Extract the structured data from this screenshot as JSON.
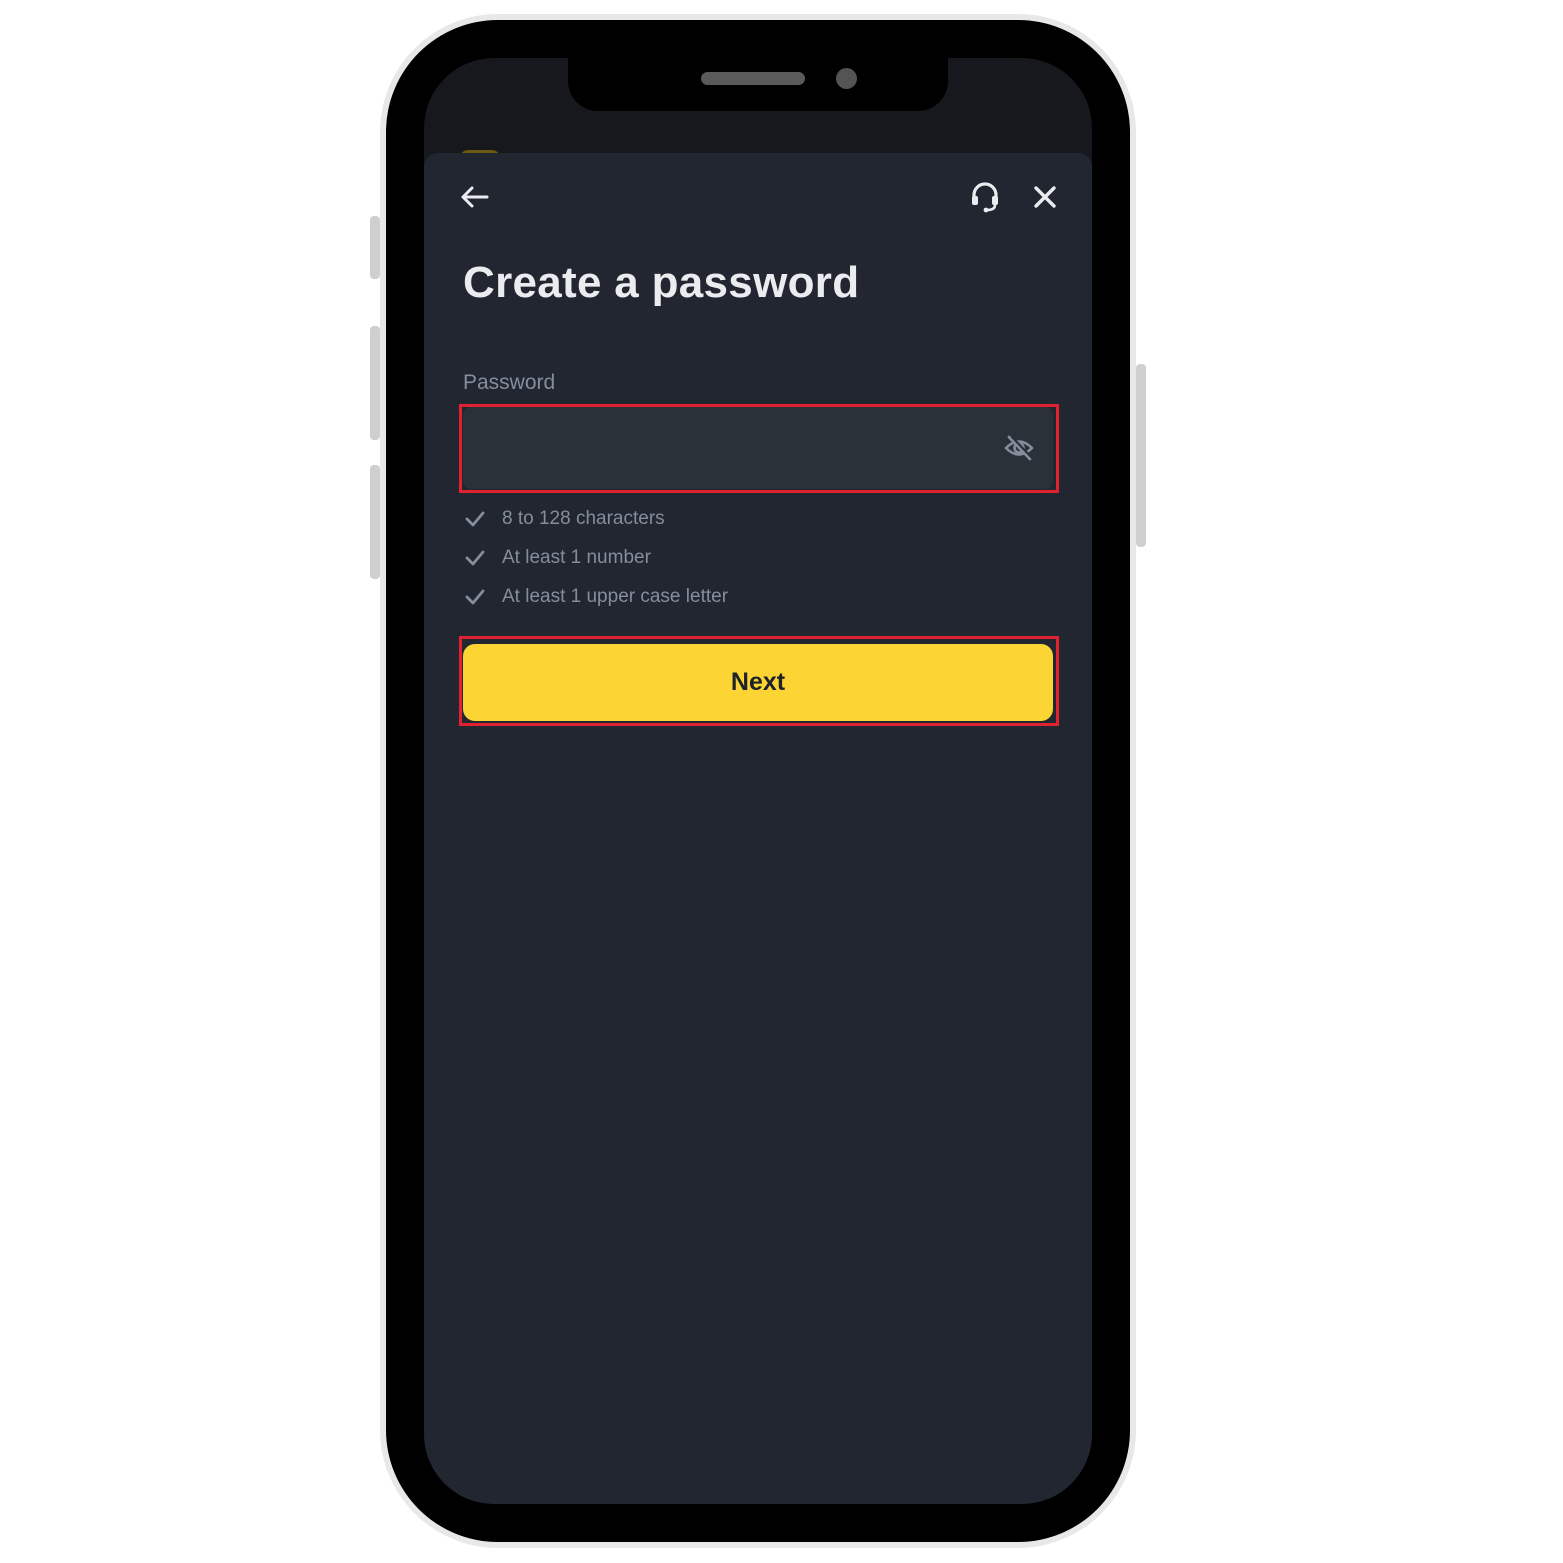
{
  "screen": {
    "title": "Create a password"
  },
  "header": {
    "back_icon": "arrow-left-icon",
    "support_icon": "headset-icon",
    "close_icon": "close-icon"
  },
  "password_field": {
    "label": "Password",
    "value": "",
    "toggle_icon": "eye-off-icon"
  },
  "requirements": [
    {
      "text": "8 to 128 characters",
      "icon": "check-icon"
    },
    {
      "text": "At least 1 number",
      "icon": "check-icon"
    },
    {
      "text": "At least 1 upper case letter",
      "icon": "check-icon"
    }
  ],
  "next_button": {
    "label": "Next"
  },
  "colors": {
    "accent": "#fcd535",
    "background": "#222630",
    "input_bg": "#2b3139",
    "highlight": "#e0212f",
    "muted_text": "#848e9c"
  }
}
